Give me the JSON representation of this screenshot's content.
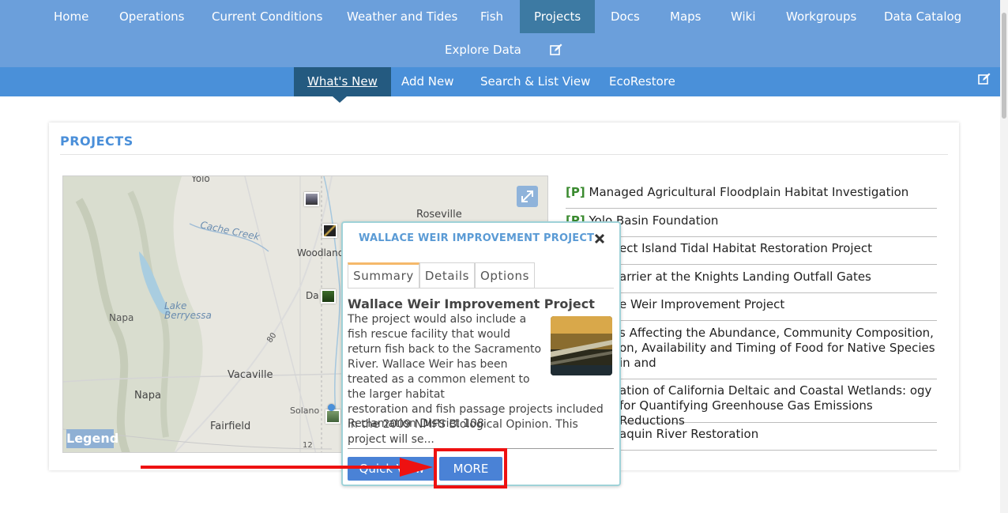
{
  "topnav": {
    "items": [
      "Home",
      "Operations",
      "Current Conditions",
      "Weather and Tides",
      "Fish",
      "Projects",
      "Docs",
      "Maps",
      "Wiki",
      "Workgroups",
      "Data Catalog"
    ],
    "active": "Projects",
    "explore": "Explore Data"
  },
  "subnav": {
    "items": [
      "What's New",
      "Add New",
      "Search & List View",
      "EcoRestore"
    ],
    "active": "What's New"
  },
  "panel": {
    "title": "PROJECTS"
  },
  "map": {
    "labels": {
      "yolo": "Yolo",
      "roseville": "Roseville",
      "cache_creek": "Cache Creek",
      "woodland": "Woodland",
      "davis": "Da",
      "lake_berryessa": "Lake Berryessa",
      "napa_area": "Napa",
      "vacaville": "Vacaville",
      "napa": "Napa",
      "solano": "Solano",
      "fairfield": "Fairfield",
      "route80": "80",
      "route12": "12"
    },
    "legend": "Legend"
  },
  "projects": [
    {
      "tag": "[P]",
      "text": "Managed Agricultural Floodplain Habitat Investigation"
    },
    {
      "tag": "[P]",
      "text": "Yolo Basin Foundation"
    },
    {
      "tag": "",
      "text": "ect Island Tidal Habitat Restoration Project"
    },
    {
      "tag": "",
      "text": "arrier at the Knights Landing Outfall Gates"
    },
    {
      "tag": "",
      "text": "e Weir Improvement Project"
    },
    {
      "tag": "",
      "text": "s Affecting the Abundance, Community Composition, on, Availability and Timing of Food for Native Species in and"
    },
    {
      "tag": "",
      "text": "ation of California Deltaic and Coastal Wetlands: ogy for Quantifying Greenhouse Gas Emissions Reductions"
    },
    {
      "tag": "",
      "text": "aquin River Restoration"
    }
  ],
  "popup": {
    "title": "WALLACE WEIR IMPROVEMENT PROJECT",
    "tabs": [
      "Summary",
      "Details",
      "Options"
    ],
    "heading": "Wallace Weir Improvement Project",
    "text_narrow": "The project would also include a fish rescue facility that would return fish back to the Sacramento River. Wallace Weir has been treated as a common element to the larger habitat",
    "text_wide": "restoration and fish passage projects included in the 2009 NMFS Biological Opinion. This project will se...",
    "owner": "Reclamation District 108",
    "quick_view": "Quick View",
    "more": "MORE"
  },
  "colors": {
    "topnav": "#6b9fdb",
    "subnav": "#4a90d9",
    "active_tab": "#3d7aa3",
    "accent": "#4a8fd9",
    "annotation": "#ee1111"
  }
}
